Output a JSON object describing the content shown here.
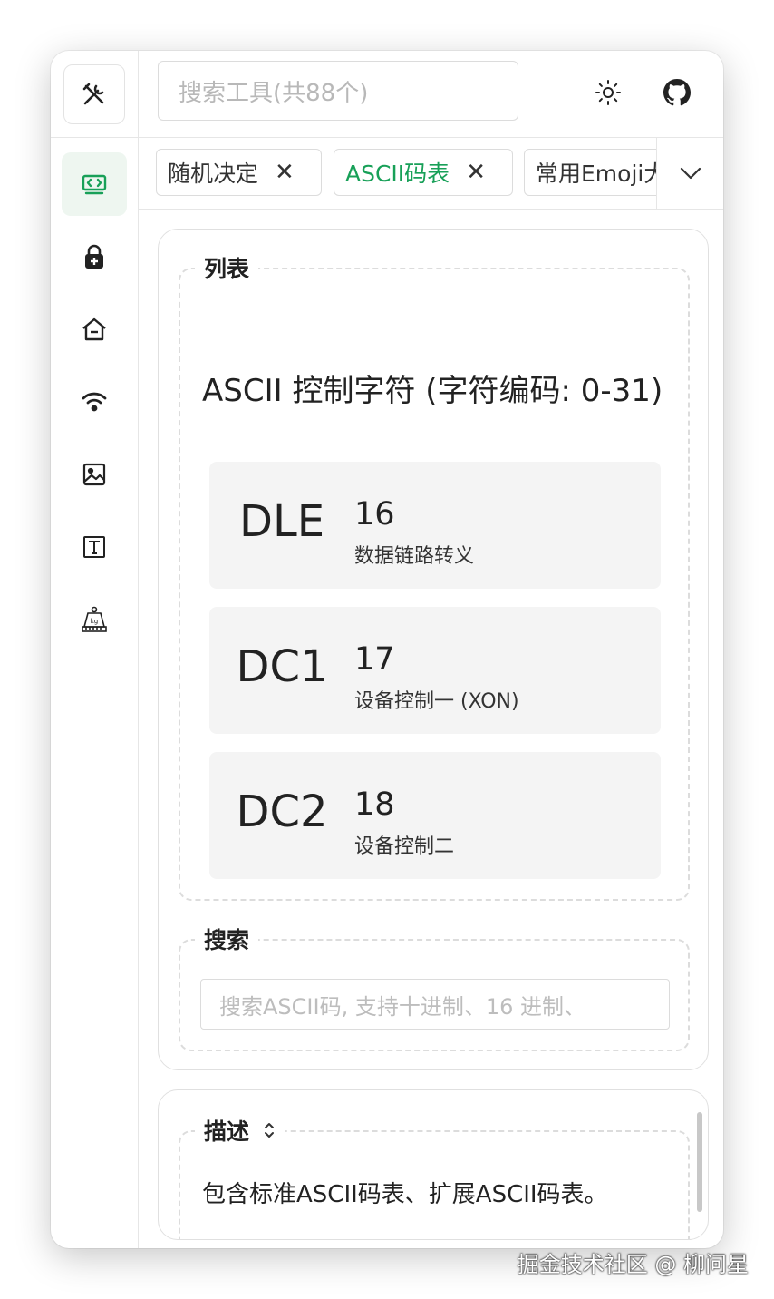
{
  "header": {
    "search_placeholder": "搜索工具(共88个)",
    "theme_icon": "sun-icon",
    "github_icon": "github-icon"
  },
  "sidebar": {
    "logo_icon": "tools-icon",
    "items": [
      {
        "icon": "ascii-code-icon",
        "active": true
      },
      {
        "icon": "lock-icon",
        "active": false
      },
      {
        "icon": "home-icon",
        "active": false
      },
      {
        "icon": "wifi-icon",
        "active": false
      },
      {
        "icon": "image-icon",
        "active": false
      },
      {
        "icon": "text-icon",
        "active": false
      },
      {
        "icon": "weight-kg-icon",
        "active": false
      }
    ]
  },
  "tabs": [
    {
      "label": "随机决定",
      "active": false
    },
    {
      "label": "ASCII码表",
      "active": true
    },
    {
      "label": "常用Emoji大",
      "active": false
    }
  ],
  "accent_color": "#18a058",
  "list_section": {
    "legend": "列表",
    "title": "ASCII 控制字符 (字符编码: 0-31)",
    "rows": [
      {
        "name": "DLE",
        "code": "16",
        "desc": "数据链路转义"
      },
      {
        "name": "DC1",
        "code": "17",
        "desc": "设备控制一 (XON)"
      },
      {
        "name": "DC2",
        "code": "18",
        "desc": "设备控制二"
      }
    ]
  },
  "search_section": {
    "legend": "搜索",
    "placeholder": "搜索ASCII码, 支持十进制、16 进制、"
  },
  "description_section": {
    "legend": "描述",
    "collapse_icon": "chevron-collapse-icon",
    "text": "包含标准ASCII码表、扩展ASCII码表。"
  },
  "watermark": "掘金技术社区 @ 柳问星"
}
